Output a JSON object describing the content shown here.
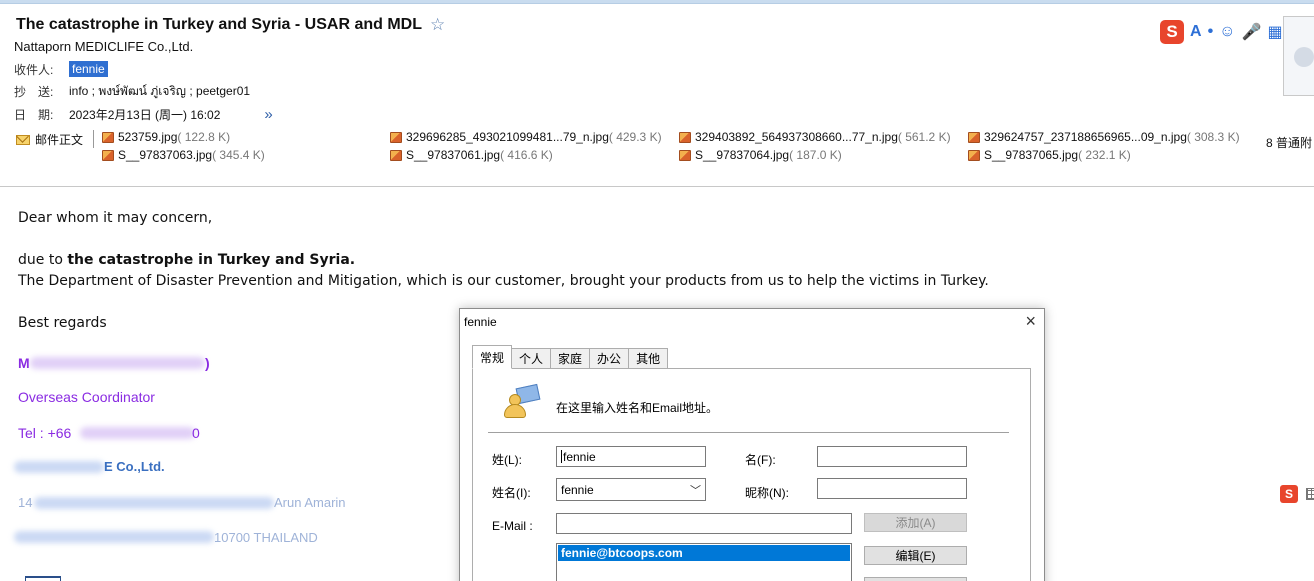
{
  "email": {
    "subject": "The catastrophe in Turkey and Syria - USAR and MDL",
    "sender": "Nattaporn MEDICLIFE Co.,Ltd.",
    "to_label": "收件人:",
    "to_value": "fennie",
    "cc_label": "抄　送:",
    "cc_value": "info ; พงษ์พัฒน์ ภู่เจริญ ; peetger01",
    "date_label": "日　期:",
    "date_value": "2023年2月13日 (周一) 16:02"
  },
  "attachments": {
    "body_label": "邮件正文",
    "count_label": "8 普通附",
    "items": [
      {
        "name": "523759.jpg",
        "size": "( 122.8 K)"
      },
      {
        "name": "329696285_493021099481...79_n.jpg",
        "size": "( 429.3 K)"
      },
      {
        "name": "329403892_564937308660...77_n.jpg",
        "size": "( 561.2 K)"
      },
      {
        "name": "329624757_237188656965...09_n.jpg",
        "size": "( 308.3 K)"
      },
      {
        "name": "S__97837063.jpg",
        "size": "( 345.4 K)"
      },
      {
        "name": "S__97837061.jpg",
        "size": "( 416.6 K)"
      },
      {
        "name": "S__97837064.jpg",
        "size": "( 187.0 K)"
      },
      {
        "name": "S__97837065.jpg",
        "size": "( 232.1 K)"
      }
    ]
  },
  "body": {
    "greeting": "Dear whom it may concern,",
    "due_prefix": "due to ",
    "due_bold": "the catastrophe in Turkey and Syria.",
    "line2": "The Department of Disaster Prevention and Mitigation, which is our customer, brought your products from us to help the victims in Turkey.",
    "regards": "Best regards",
    "sig_name": "M",
    "sig_name_end": ")",
    "sig_title": "Overseas Coordinator",
    "sig_tel": "Tel : +66",
    "sig_tel_end": "0",
    "sig_company": "E Co.,Ltd.",
    "sig_addr1_a": "14",
    "sig_addr1_b": "Arun Amarin",
    "sig_addr2": "10700 THAILAND"
  },
  "dialog": {
    "title": "fennie",
    "close": "×",
    "tabs": [
      "常规",
      "个人",
      "家庭",
      "办公",
      "其他"
    ],
    "intro": "在这里输入姓名和Email地址。",
    "surname_label": "姓(L):",
    "surname_value": "fennie",
    "given_label": "名(F):",
    "given_value": "",
    "fullname_label": "姓名(I):",
    "fullname_value": "fennie",
    "nickname_label": "昵称(N):",
    "nickname_value": "",
    "email_label": "E-Mail :",
    "email_value": "",
    "add_button": "添加(A)",
    "edit_button": "编辑(E)",
    "email_list": [
      "fennie@btcoops.com"
    ]
  },
  "ime": {
    "logo": "S",
    "glyphs": [
      "A",
      "•",
      "☺",
      "🎤",
      "▦"
    ]
  },
  "colors": {
    "signature": "#8a2be2",
    "selection": "#0078d7",
    "to_chip": "#2f6fd1"
  }
}
